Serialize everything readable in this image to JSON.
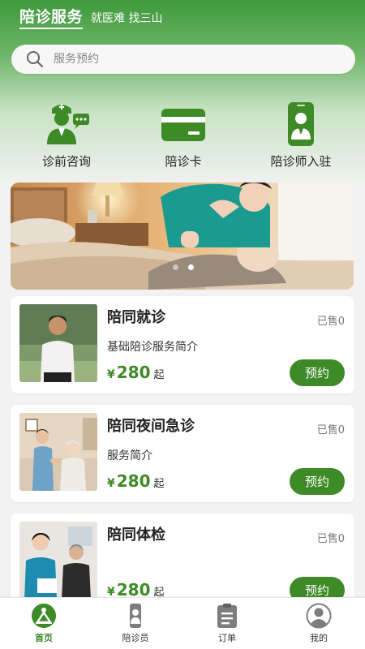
{
  "header": {
    "title": "陪诊服务",
    "slogan": "就医难 找三山"
  },
  "search": {
    "placeholder": "服务预约",
    "icon": "search-icon"
  },
  "quick_entries": [
    {
      "label": "诊前咨询",
      "icon": "doctor-consult-icon"
    },
    {
      "label": "陪诊卡",
      "icon": "card-icon"
    },
    {
      "label": "陪诊师入驻",
      "icon": "escort-staff-icon"
    }
  ],
  "banner": {
    "slides": 2,
    "active": 1
  },
  "services": [
    {
      "title": "陪同就诊",
      "sold": "已售0",
      "desc": "基础陪诊服务简介",
      "price_symbol": "¥",
      "price": "280",
      "unit": "起",
      "button": "预约"
    },
    {
      "title": "陪同夜间急诊",
      "sold": "已售0",
      "desc": "服务简介",
      "price_symbol": "¥",
      "price": "280",
      "unit": "起",
      "button": "预约"
    },
    {
      "title": "陪同体检",
      "sold": "已售0",
      "desc": "",
      "price_symbol": "¥",
      "price": "280",
      "unit": "起",
      "button": "预约"
    }
  ],
  "tabbar": [
    {
      "label": "首页",
      "icon": "home-icon",
      "active": true
    },
    {
      "label": "陪诊员",
      "icon": "escort-icon",
      "active": false
    },
    {
      "label": "订单",
      "icon": "order-icon",
      "active": false
    },
    {
      "label": "我的",
      "icon": "profile-icon",
      "active": false
    }
  ],
  "colors": {
    "primary": "#3e8a27",
    "header_green": "#3f9a3c"
  }
}
